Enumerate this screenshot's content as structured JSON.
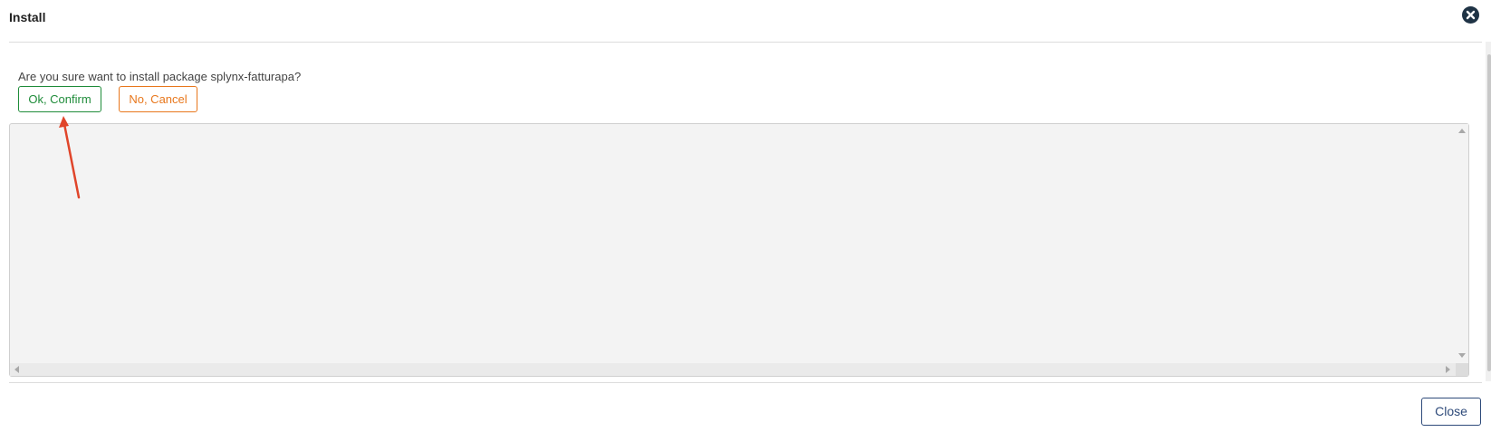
{
  "modal": {
    "title": "Install",
    "question": "Are you sure want to install package splynx-fatturapa?",
    "confirm_label": "Ok, Confirm",
    "cancel_label": "No, Cancel",
    "output_text": "",
    "close_label": "Close"
  },
  "icons": {
    "header_close": "close-circle-icon"
  },
  "colors": {
    "confirm": "#1f8c3a",
    "cancel": "#e8771c",
    "close_button": "#2e4a7a",
    "annotation_arrow": "#e0452a"
  }
}
